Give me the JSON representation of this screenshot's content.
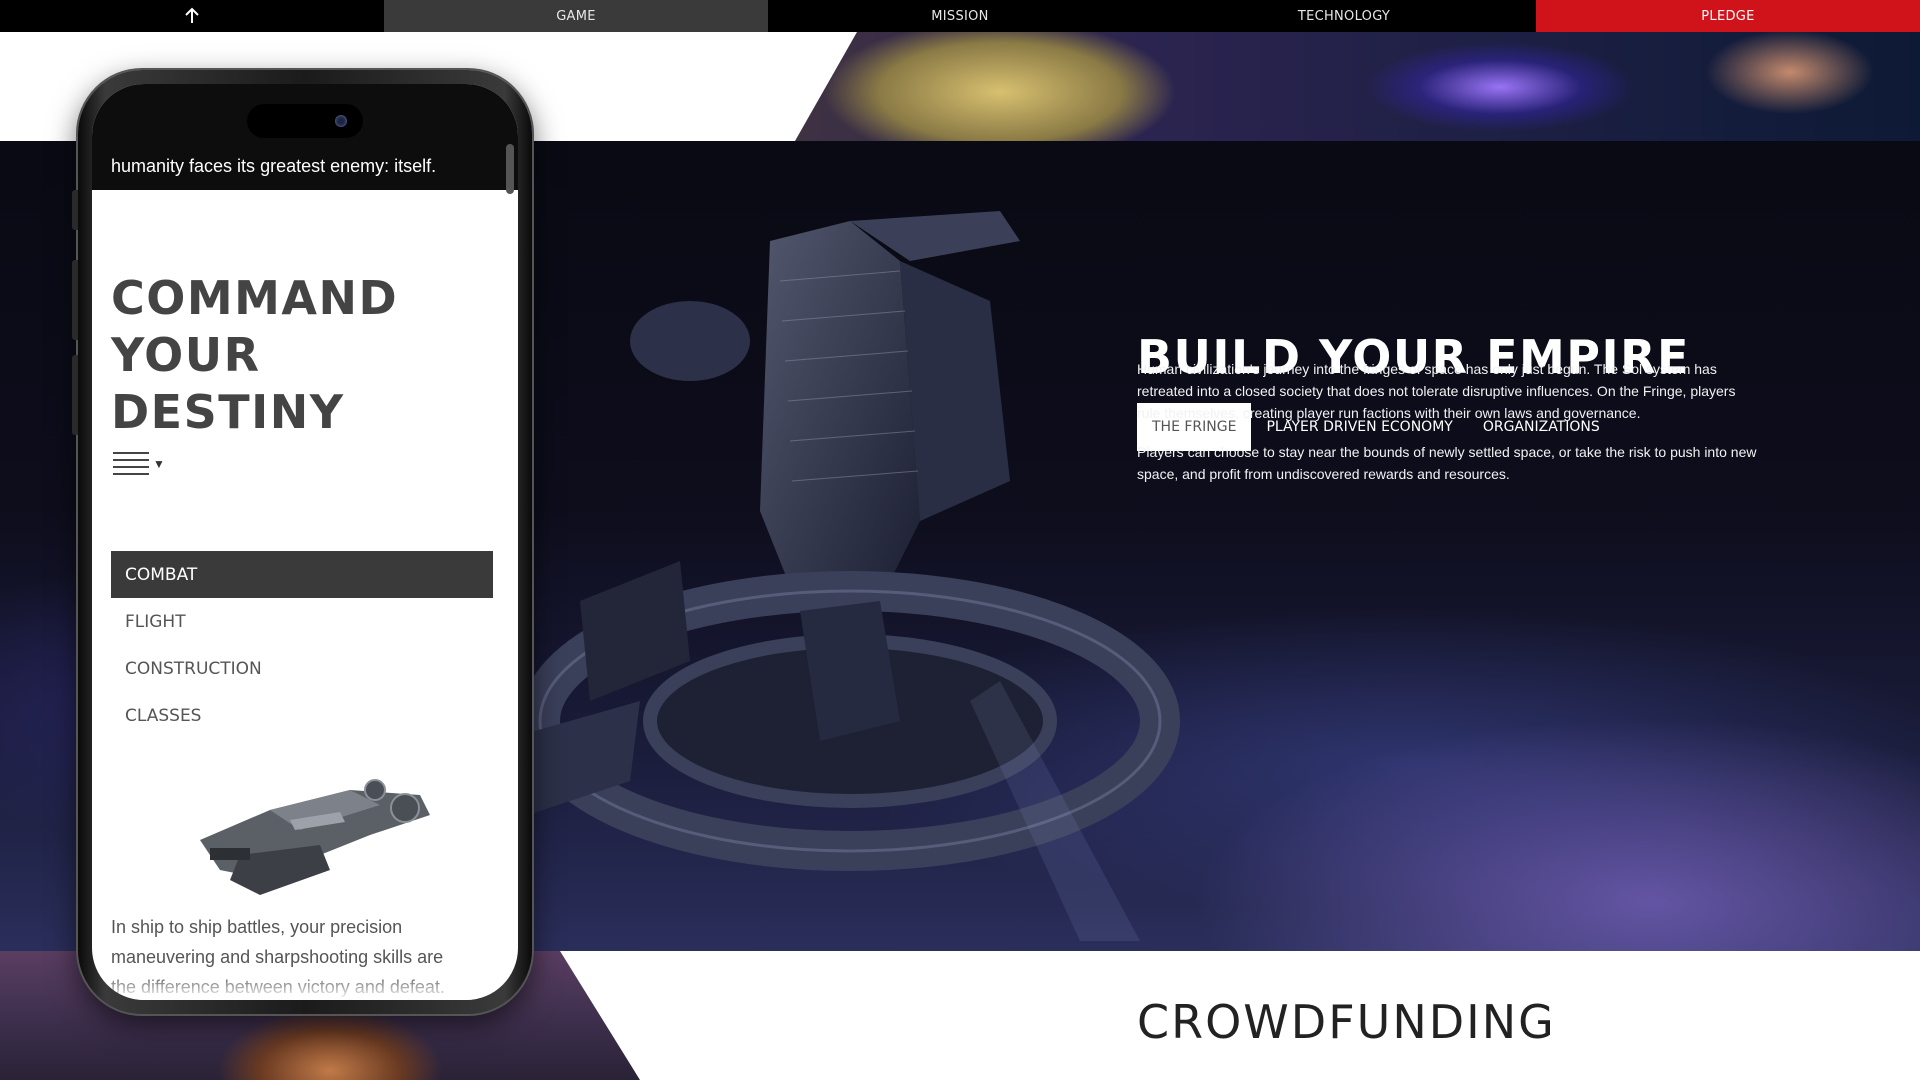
{
  "nav": {
    "items": [
      {
        "label": ""
      },
      {
        "label": "GAME"
      },
      {
        "label": "MISSION"
      },
      {
        "label": "TECHNOLOGY"
      },
      {
        "label": "PLEDGE"
      }
    ],
    "back_icon": "arrow-up-icon",
    "active_index": 1,
    "pledge_color": "#d0121b"
  },
  "empire": {
    "title": "BUILD YOUR EMPIRE",
    "tabs": [
      {
        "label": "THE FRINGE",
        "active": true
      },
      {
        "label": "PLAYER DRIVEN ECONOMY",
        "active": false
      },
      {
        "label": "ORGANIZATIONS",
        "active": false
      }
    ],
    "paragraphs": [
      "Human civilization's journey into the fringes of space has only just begun. The Sol system has retreated into a closed society that does not tolerate disruptive influences. On the Fringe, players rule themselves, creating player run factions with their own laws and governance.",
      "Players can choose to stay near the bounds of newly settled space, or take the risk to push into new space, and profit from undiscovered rewards and resources."
    ]
  },
  "phone": {
    "tagline": "humanity faces its greatest enemy: itself.",
    "title": "COMMAND YOUR DESTINY",
    "menu_icon": "hamburger-menu-icon",
    "menu": [
      {
        "label": "COMBAT",
        "active": true
      },
      {
        "label": "FLIGHT",
        "active": false
      },
      {
        "label": "CONSTRUCTION",
        "active": false
      },
      {
        "label": "CLASSES",
        "active": false
      }
    ],
    "description": "In ship to ship battles, your precision maneuvering and sharpshooting skills are the difference between victory and defeat."
  },
  "crowdfunding": {
    "title": "CROWDFUNDING"
  }
}
